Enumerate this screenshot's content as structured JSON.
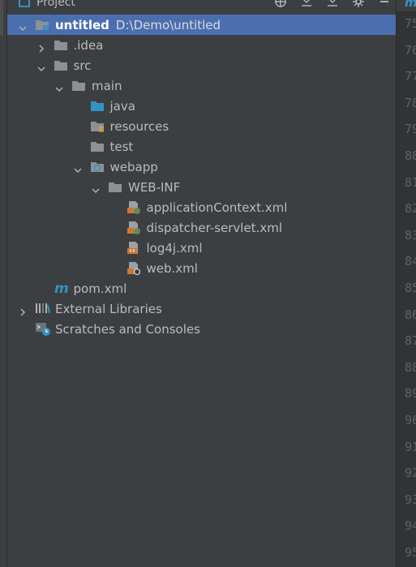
{
  "header": {
    "title": "Project"
  },
  "tree": [
    {
      "label": "untitled",
      "path": "D:\\Demo\\untitled",
      "depth": 0,
      "expanded": true,
      "selected": true,
      "icon": "module-folder-icon"
    },
    {
      "label": ".idea",
      "depth": 1,
      "expanded": false,
      "icon": "folder-icon"
    },
    {
      "label": "src",
      "depth": 1,
      "expanded": true,
      "icon": "folder-icon"
    },
    {
      "label": "main",
      "depth": 2,
      "expanded": true,
      "icon": "folder-icon"
    },
    {
      "label": "java",
      "depth": 3,
      "icon": "source-folder-icon"
    },
    {
      "label": "resources",
      "depth": 3,
      "icon": "resources-folder-icon"
    },
    {
      "label": "test",
      "depth": 3,
      "icon": "folder-icon"
    },
    {
      "label": "webapp",
      "depth": 3,
      "expanded": true,
      "icon": "web-folder-icon"
    },
    {
      "label": "WEB-INF",
      "depth": 4,
      "expanded": true,
      "icon": "folder-icon"
    },
    {
      "label": "applicationContext.xml",
      "depth": 5,
      "icon": "spring-xml-icon"
    },
    {
      "label": "dispatcher-servlet.xml",
      "depth": 5,
      "icon": "spring-xml-icon"
    },
    {
      "label": "log4j.xml",
      "depth": 5,
      "icon": "xml-file-icon"
    },
    {
      "label": "web.xml",
      "depth": 5,
      "icon": "web-xml-icon"
    },
    {
      "label": "pom.xml",
      "depth": 1,
      "icon": "maven-icon"
    },
    {
      "label": "External Libraries",
      "depth": 0,
      "expanded": false,
      "icon": "libraries-icon"
    },
    {
      "label": "Scratches and Consoles",
      "depth": 0,
      "icon": "scratches-icon"
    }
  ],
  "gutter": {
    "line_numbers": [
      "75",
      "76",
      "77",
      "78",
      "79",
      "80",
      "81",
      "82",
      "83",
      "84",
      "85",
      "86",
      "87",
      "88",
      "89",
      "90",
      "91",
      "92",
      "93",
      "94",
      "95"
    ],
    "tab_glyph": "m"
  },
  "colors": {
    "selection": "#4b6eaf",
    "folder": "#8d9196",
    "source_folder": "#3592c4",
    "spring_green": "#6a8759",
    "xml_orange": "#cc7832"
  }
}
